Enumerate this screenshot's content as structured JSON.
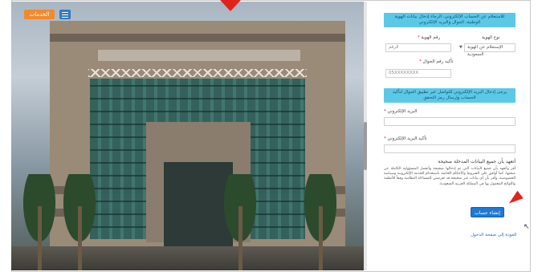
{
  "toolbar": {
    "action_label": "الخدمات",
    "menu_icon": "hamburger-menu-icon"
  },
  "form": {
    "banner_top": "للاستعلام عن الحساب الإلكتروني، الرجاء إدخال بيانات الهوية الوطنية، الجوال والبريد الإلكتروني",
    "id_type_label": "نوع الهوية",
    "id_type_value": "الإستعلام عن الهوية السعودية",
    "id_number_label": "رقم الهوية",
    "id_number_placeholder": "الرقم",
    "mobile_label": "تأكيد رقم الجوال",
    "mobile_placeholder": "05XXXXXXXX",
    "banner_mid": "يرجى إدخال البريد الإلكتروني للتواصل عبر تطبيق الجوال لتأكيد الحساب وإرسال رمز التحقق",
    "email_label": "البريد الإلكتروني",
    "email_confirm_label": "تأكيد البريد الإلكتروني",
    "terms_title": "أتعهد بأن جميع البيانات المدخلة صحيحة",
    "terms_body": "أقر وأتعهد بأن جميع البيانات التي تم إدخالها صحيحة وأتحمل المسؤولية الكاملة عن صحتها، كما أوافق على الشروط والأحكام الخاصة باستخدام الخدمة الإلكترونية وسياسة الخصوصية، وأقر بأن أي بيانات غير صحيحة قد تعرضني للمساءلة النظامية وفقاً للأنظمة واللوائح المعمول بها في المملكة العربية السعودية.",
    "submit_label": "إنشاء حساب",
    "bottom_link": "العودة إلى صفحة الدخول"
  },
  "colors": {
    "banner": "#5bc8e8",
    "submit": "#1e78d6",
    "marker": "#e0231b",
    "action": "#f08a2c"
  }
}
